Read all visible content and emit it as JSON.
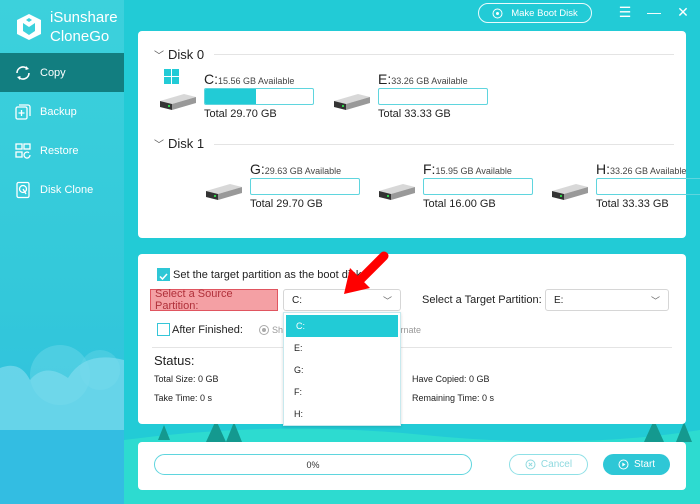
{
  "app": {
    "name_line1": "iSunshare",
    "name_line2": "CloneGo"
  },
  "sidebar": {
    "items": [
      {
        "label": "Copy",
        "icon": "refresh-icon",
        "active": true
      },
      {
        "label": "Backup",
        "icon": "backup-icon",
        "active": false
      },
      {
        "label": "Restore",
        "icon": "restore-icon",
        "active": false
      },
      {
        "label": "Disk Clone",
        "icon": "disk-clone-icon",
        "active": false
      }
    ]
  },
  "topbar": {
    "make_boot_disk": "Make Boot Disk",
    "menu_icon": "menu-icon",
    "minimize_icon": "minimize-icon",
    "close_icon": "close-icon"
  },
  "disks": [
    {
      "name": "Disk 0",
      "partitions": [
        {
          "letter": "C:",
          "available": "15.56 GB Available",
          "total": "Total 29.70 GB",
          "used_fraction": 0.476,
          "system": true
        },
        {
          "letter": "E:",
          "available": "33.26 GB Available",
          "total": "Total 33.33 GB",
          "used_fraction": 0.0,
          "system": false
        }
      ]
    },
    {
      "name": "Disk 1",
      "partitions": [
        {
          "letter": "G:",
          "available": "29.63 GB Available",
          "total": "Total 29.70 GB",
          "used_fraction": 0.0,
          "system": false
        },
        {
          "letter": "F:",
          "available": "15.95 GB Available",
          "total": "Total 16.00 GB",
          "used_fraction": 0.0,
          "system": false
        },
        {
          "letter": "H:",
          "available": "33.26 GB Available",
          "total": "Total 33.33 GB",
          "used_fraction": 0.0,
          "system": false
        }
      ]
    }
  ],
  "options": {
    "boot_disk_label": "Set the target partition as the boot disk",
    "boot_disk_checked": true,
    "source_label": "Select a Source Partition:",
    "source_value": "C:",
    "target_label": "Select a Target Partition:",
    "target_value": "E:",
    "after_finished_label": "After Finished:",
    "after_finished_checked": false,
    "radio_shutdown": "Shut down",
    "radio_hibernate": "Hibernate",
    "source_options": [
      "C:",
      "E:",
      "G:",
      "F:",
      "H:"
    ]
  },
  "status": {
    "title": "Status:",
    "total_size": "Total Size: 0 GB",
    "take_time": "Take Time: 0 s",
    "have_copied": "Have Copied: 0 GB",
    "remaining_time": "Remaining Time: 0 s"
  },
  "footer": {
    "progress_percent": 0,
    "progress_label": "0%",
    "cancel": "Cancel",
    "start": "Start"
  },
  "colors": {
    "accent": "#22cbd6",
    "active_nav": "#127e80",
    "highlight": "#f4a0a4",
    "arrow": "#ff0000"
  }
}
